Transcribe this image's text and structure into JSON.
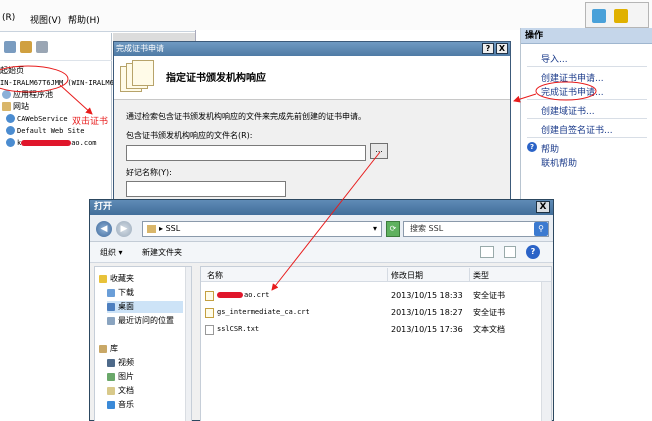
{
  "menubar": {
    "items": [
      "(R)",
      "视图(V)",
      "帮助(H)"
    ]
  },
  "tree": {
    "start_page": "起始页",
    "server": "IN-IRALM67T6JMM (WIN-IRALM67T",
    "app_pools": "应用程序池",
    "sites": "网站",
    "site1": "CAWebService",
    "site2": "Default Web Site",
    "site3_prefix": "k",
    "site3_suffix": "ao.com",
    "annotation_dblclick": "双击证书"
  },
  "actions": {
    "header": "操作",
    "items": [
      "导入...",
      "创建证书申请...",
      "完成证书申请...",
      "创建域证书...",
      "创建自签名证书..."
    ],
    "help": "帮助",
    "online_help": "联机帮助"
  },
  "cert_dialog": {
    "title": "完成证书申请",
    "help_btn": "?",
    "close_btn": "X",
    "heading": "指定证书颁发机构响应",
    "description": "通过检索包含证书颁发机构响应的文件来完成先前创建的证书申请。",
    "file_label": "包含证书颁发机构响应的文件名(R):",
    "file_value": "",
    "browse_btn": "...",
    "friendly_label": "好记名称(Y):",
    "friendly_value": ""
  },
  "open_dialog": {
    "title": "打开",
    "close_btn": "X",
    "back": "◀",
    "forward": "▶",
    "address_sep": "▸",
    "address_folder": "SSL",
    "refresh": "⟳",
    "search_placeholder": "搜索 SSL",
    "search_icon": "⚲",
    "toolbar": {
      "organize": "组织 ▾",
      "new_folder": "新建文件夹"
    },
    "sidebar": {
      "favorites": "收藏夹",
      "items": [
        "下载",
        "桌面",
        "最近访问的位置"
      ],
      "library": "库",
      "library_items": [
        "视频",
        "图片",
        "文档",
        "音乐"
      ]
    },
    "columns": {
      "name": "名称",
      "date": "修改日期",
      "type": "类型"
    },
    "files": [
      {
        "name_suffix": "ao.crt",
        "date": "2013/10/15 18:33",
        "type": "安全证书"
      },
      {
        "name": "gs_intermediate_ca.crt",
        "date": "2013/10/15 18:27",
        "type": "安全证书"
      },
      {
        "name": "sslCSR.txt",
        "date": "2013/10/15 17:36",
        "type": "文本文档"
      }
    ]
  },
  "colors": {
    "annotation_red": "#e81c1c",
    "titlebar_blue": "#4f7aa5",
    "link_blue": "#1a3a8a"
  }
}
